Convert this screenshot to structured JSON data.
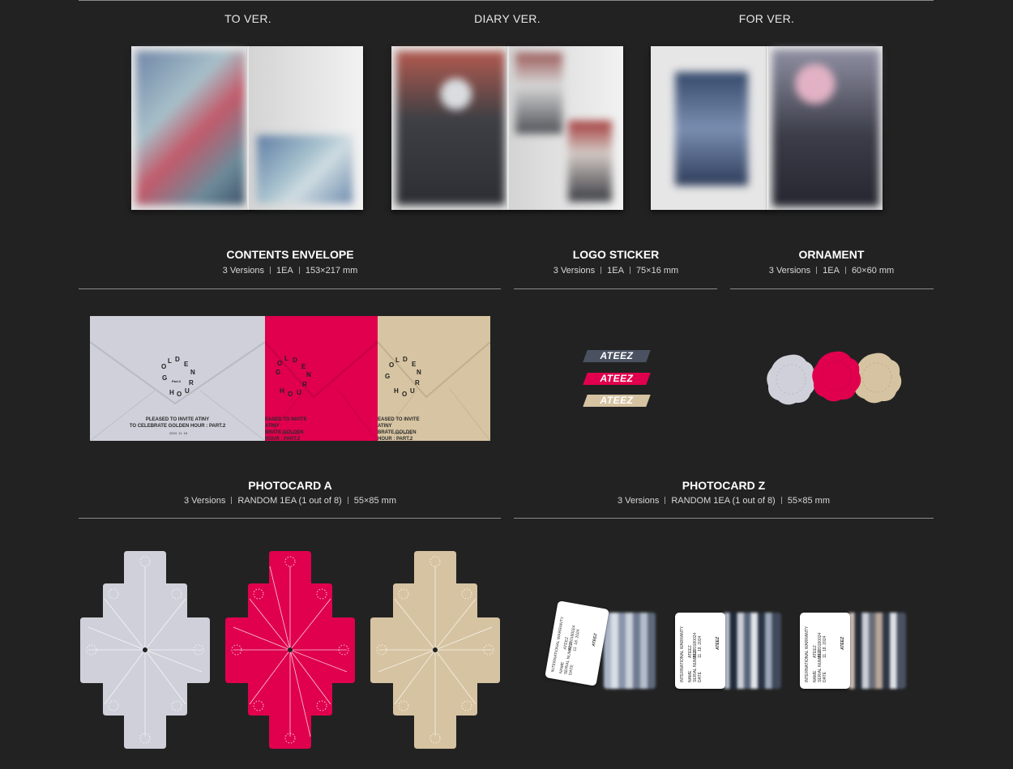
{
  "photobook_versions": [
    {
      "label": "TO VER."
    },
    {
      "label": "DIARY VER."
    },
    {
      "label": "FOR VER."
    }
  ],
  "sections": {
    "contents_envelope": {
      "title": "CONTENTS ENVELOPE",
      "versions": "3 Versions",
      "qty": "1EA",
      "size": "153×217 mm"
    },
    "logo_sticker": {
      "title": "LOGO STICKER",
      "versions": "3 Versions",
      "qty": "1EA",
      "size": "75×16 mm"
    },
    "ornament": {
      "title": "ORNAMENT",
      "versions": "3 Versions",
      "qty": "1EA",
      "size": "60×60 mm"
    },
    "photocard_a": {
      "title": "PHOTOCARD A",
      "versions": "3 Versions",
      "qty": "RANDOM 1EA (1 out of 8)",
      "size": "55×85 mm"
    },
    "photocard_z": {
      "title": "PHOTOCARD Z",
      "versions": "3 Versions",
      "qty": "RANDOM 1EA (1 out of 8)",
      "size": "55×85 mm"
    }
  },
  "envelope": {
    "logo_letters": [
      "G",
      "O",
      "L",
      "D",
      "E",
      "N",
      "H",
      "O",
      "U",
      "R"
    ],
    "part_label": "Part.2",
    "line1": "PLEASED TO INVITE ATINY",
    "line2": "TO CELEBRATE GOLDEN HOUR : PART.2",
    "line1_cut": "EASED TO INVITE ATINY",
    "line2_cut": "BRATE GOLDEN HOUR : PART.2",
    "date": "2024. 11. 18"
  },
  "sticker": {
    "text": "ATEEZ"
  },
  "photocard_z": {
    "card_lines": [
      "INTERNATIONAL WARRANTY",
      "NAME",
      "SERIAL NUMBER",
      "DATE"
    ],
    "name_value": "ATEEZ",
    "serial_value": "ATZ20180024",
    "date_value": "11. 18. 2024",
    "brand": "ATEEZ"
  },
  "colors": {
    "background": "#222222",
    "silver": "#cfd0d8",
    "red": "#e0004d",
    "beige": "#d6c3a1",
    "sticker_dark": "#4a5161"
  }
}
